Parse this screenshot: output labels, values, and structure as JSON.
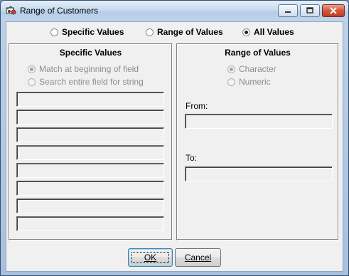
{
  "window": {
    "title": "Range of Customers",
    "icon": "customers-app-icon"
  },
  "mode": {
    "options": [
      {
        "label": "Specific Values",
        "selected": false
      },
      {
        "label": "Range of Values",
        "selected": false
      },
      {
        "label": "All Values",
        "selected": true
      }
    ]
  },
  "specific": {
    "title": "Specific Values",
    "options": [
      {
        "label": "Match at beginning of field",
        "selected": true
      },
      {
        "label": "Search entire field for string",
        "selected": false
      }
    ],
    "fields": [
      "",
      "",
      "",
      "",
      "",
      "",
      "",
      ""
    ]
  },
  "range": {
    "title": "Range of Values",
    "options": [
      {
        "label": "Character",
        "selected": true
      },
      {
        "label": "Numeric",
        "selected": false
      }
    ],
    "from_label": "From:",
    "from_value": "",
    "to_label": "To:",
    "to_value": ""
  },
  "buttons": {
    "ok": "OK",
    "cancel": "Cancel"
  }
}
